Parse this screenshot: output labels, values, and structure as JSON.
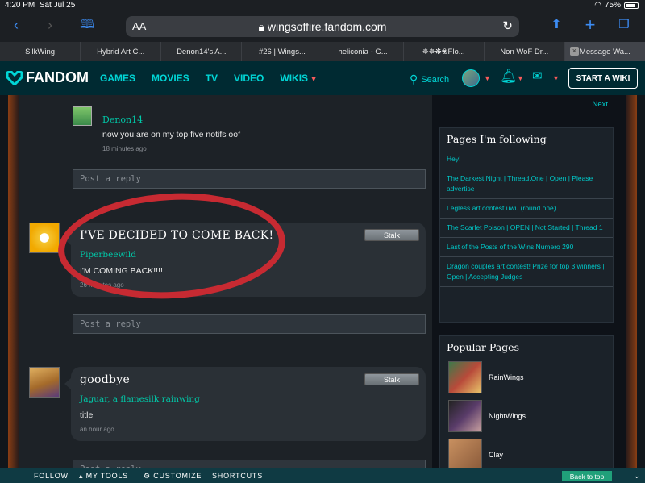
{
  "status": {
    "time": "4:20 PM",
    "date": "Sat Jul 25",
    "battery": "75%",
    "battery_level": 0.75
  },
  "browser": {
    "text_size_label": "AA",
    "url": "wingsoffire.fandom.com",
    "tabs": [
      {
        "label": "SilkWing",
        "active": false
      },
      {
        "label": "Hybrid Art C...",
        "active": false
      },
      {
        "label": "Denon14's A...",
        "active": false
      },
      {
        "label": "#26 | Wings...",
        "active": false
      },
      {
        "label": "heliconia - G...",
        "active": false
      },
      {
        "label": "✵✵❋❀Flo...",
        "active": false
      },
      {
        "label": "Non WoF Dr...",
        "active": false
      },
      {
        "label": "Message Wa...",
        "active": true
      }
    ],
    "icons": [
      "back-icon",
      "forward-icon",
      "bookmarks-icon",
      "lock-icon",
      "reload-icon",
      "share-icon",
      "add-tab-icon",
      "tabs-icon"
    ]
  },
  "nav": {
    "logo": "FANDOM",
    "links": [
      "GAMES",
      "MOVIES",
      "TV",
      "VIDEO",
      "WIKIS"
    ],
    "search_label": "Search",
    "start_wiki": "START A WIKI",
    "accent": "#00d6d6",
    "bg": "#002a32"
  },
  "thread": {
    "reply": {
      "author": "Denon14",
      "text": "now you are on my top five notifs oof",
      "time": "18 minutes ago"
    },
    "reply_placeholder": "Post a reply",
    "posts": [
      {
        "title": "I'VE DECIDED TO COME BACK!",
        "stalk": "Stalk",
        "author": "Piperbeewild",
        "text": "I'M COMING BACK!!!!",
        "time": "26 minutes ago",
        "circled": true
      },
      {
        "title": "goodbye",
        "stalk": "Stalk",
        "author": "Jaguar, a flamesilk rainwing",
        "text": "title",
        "time": "an hour ago",
        "circled": false
      }
    ]
  },
  "rail": {
    "next": "Next",
    "following_title": "Pages I'm following",
    "following": [
      "Hey!",
      "The Darkest Night | Thread.One | Open | Please advertise",
      "Legless art contest uwu (round one)",
      "The Scarlet Poison | OPEN | Not Started | Thread 1",
      "Last of the Posts of the Wins Numero 290",
      "Dragon couples art contest! Prize for top 3 winners | Open | Accepting Judges"
    ],
    "popular_title": "Popular Pages",
    "popular": [
      "RainWings",
      "NightWings",
      "Clay"
    ]
  },
  "bottom": {
    "follow": "FOLLOW",
    "my_tools": "MY TOOLS",
    "customize": "CUSTOMIZE",
    "shortcuts": "SHORTCUTS",
    "back_to_top": "Back to top"
  }
}
